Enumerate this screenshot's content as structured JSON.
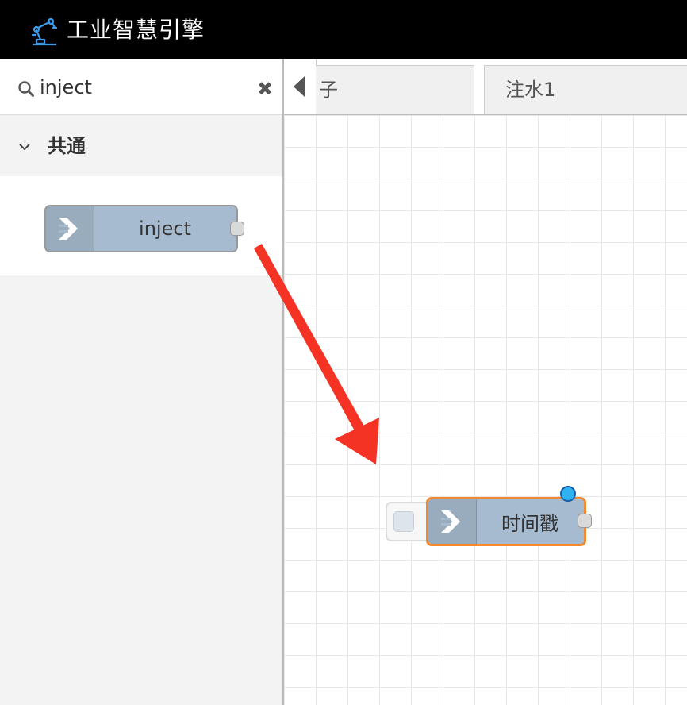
{
  "header": {
    "title": "工业智慧引擎",
    "logo_icon": "robot-arm-icon"
  },
  "palette": {
    "search": {
      "value": "inject",
      "icon": "search-icon",
      "clear_icon": "close-icon"
    },
    "category": {
      "label": "共通",
      "expanded": true
    },
    "nodes": [
      {
        "label": "inject",
        "icon": "arrow-right-icon",
        "color": "#a6bbcf"
      }
    ]
  },
  "workspace": {
    "tabs": [
      {
        "label": "子"
      },
      {
        "label": "注水1"
      }
    ],
    "nodes": [
      {
        "label": "时间戳",
        "icon": "arrow-right-icon",
        "color": "#a6bbcf",
        "selected": true,
        "changed": true,
        "selection_color": "#f08a32"
      }
    ]
  },
  "annotation": {
    "arrow_color": "#f53325"
  }
}
